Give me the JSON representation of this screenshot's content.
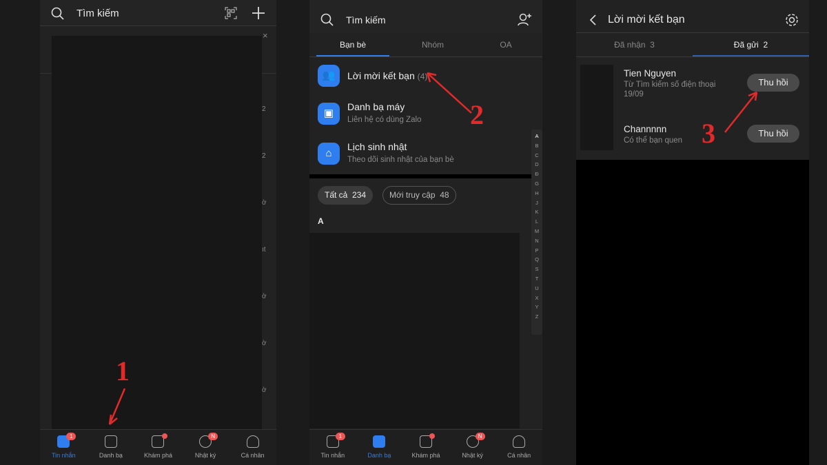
{
  "nav": [
    {
      "label": "Tin nhắn",
      "badge": "1"
    },
    {
      "label": "Danh bạ",
      "badge": ""
    },
    {
      "label": "Khám phá",
      "badge": ""
    },
    {
      "label": "Nhật ký",
      "badge": "N"
    },
    {
      "label": "Cá nhân",
      "badge": ""
    }
  ],
  "panel1": {
    "search_placeholder": "Tìm kiếm",
    "right_snippets": [
      "2",
      "2",
      "ờ",
      "ıt",
      "ờ",
      "",
      "ờ",
      "ờ"
    ],
    "annotation": "1"
  },
  "panel2": {
    "search_placeholder": "Tìm kiếm",
    "tabs": [
      "Bạn bè",
      "Nhóm",
      "OA"
    ],
    "items": [
      {
        "title": "Lời mời kết bạn",
        "count": "(4)",
        "subtitle": ""
      },
      {
        "title": "Danh bạ máy",
        "subtitle": "Liên hệ có dùng Zalo"
      },
      {
        "title": "Lịch sinh nhật",
        "subtitle": "Theo dõi sinh nhật của bạn bè"
      }
    ],
    "chips": [
      {
        "label": "Tất cả",
        "count": "234"
      },
      {
        "label": "Mới truy cập",
        "count": "48"
      }
    ],
    "section": "A",
    "alphabet": [
      "A",
      "B",
      "C",
      "D",
      "Đ",
      "G",
      "H",
      "J",
      "K",
      "L",
      "M",
      "N",
      "P",
      "Q",
      "S",
      "T",
      "U",
      "X",
      "Y",
      "Z"
    ],
    "annotation": "2"
  },
  "panel3": {
    "title": "Lời mời kết bạn",
    "tabs": [
      {
        "label": "Đã nhận",
        "count": "3"
      },
      {
        "label": "Đã gửi",
        "count": "2"
      }
    ],
    "requests": [
      {
        "name": "Tien Nguyen",
        "source": "Từ Tìm kiếm số điện thoại",
        "date": "19/09",
        "action": "Thu hồi"
      },
      {
        "name": "Channnnn",
        "source": "Có thể bạn quen",
        "date": "",
        "action": "Thu hồi"
      }
    ],
    "annotation": "3"
  },
  "colors": {
    "accent": "#2f7ef0",
    "badge": "#e55555",
    "annotation": "#e12b2b"
  }
}
